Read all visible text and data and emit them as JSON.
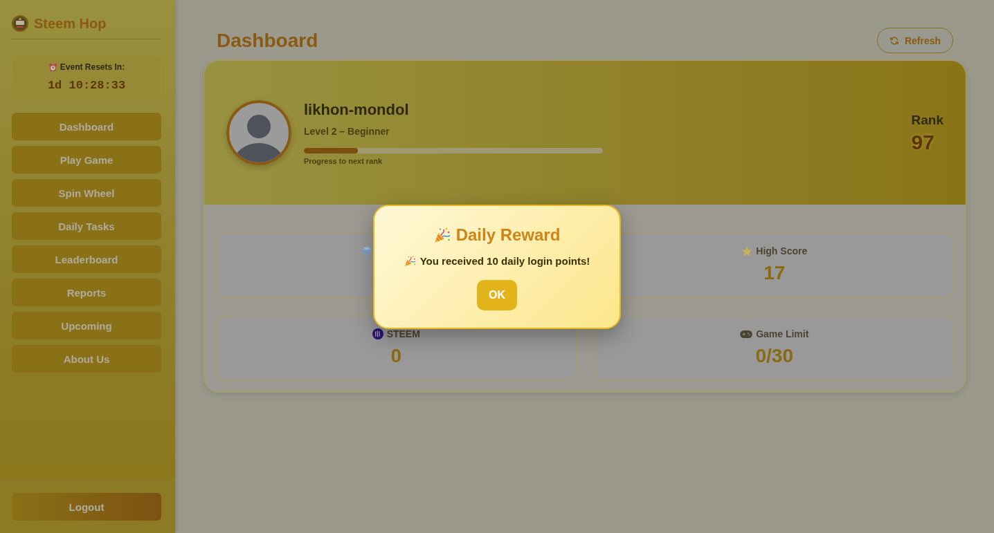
{
  "sidebar": {
    "brand": "Steem Hop",
    "countdown": {
      "label": "Event Resets In:",
      "value": "1d 10:28:33"
    },
    "nav": [
      "Dashboard",
      "Play Game",
      "Spin Wheel",
      "Daily Tasks",
      "Leaderboard",
      "Reports",
      "Upcoming",
      "About Us"
    ],
    "logout": "Logout"
  },
  "header": {
    "title": "Dashboard",
    "refresh": "Refresh"
  },
  "profile": {
    "username": "likhon-mondol",
    "level_text": "Level 2 – Beginner",
    "progress": {
      "level": 0.18,
      "caption": "Progress to next rank"
    },
    "rank_label": "Rank",
    "rank": "97"
  },
  "stats": [
    {
      "kind": "gem"
    },
    {
      "kind": "star",
      "label": "High Score",
      "value": "17"
    },
    {
      "kind": "steem",
      "label": "STEEM",
      "value": "0"
    },
    {
      "kind": "gamepad",
      "label": "Game Limit",
      "value": "0/30"
    }
  ],
  "dialog": {
    "title": "Daily Reward",
    "message": "You received 10 daily login points!",
    "button": "OK"
  }
}
